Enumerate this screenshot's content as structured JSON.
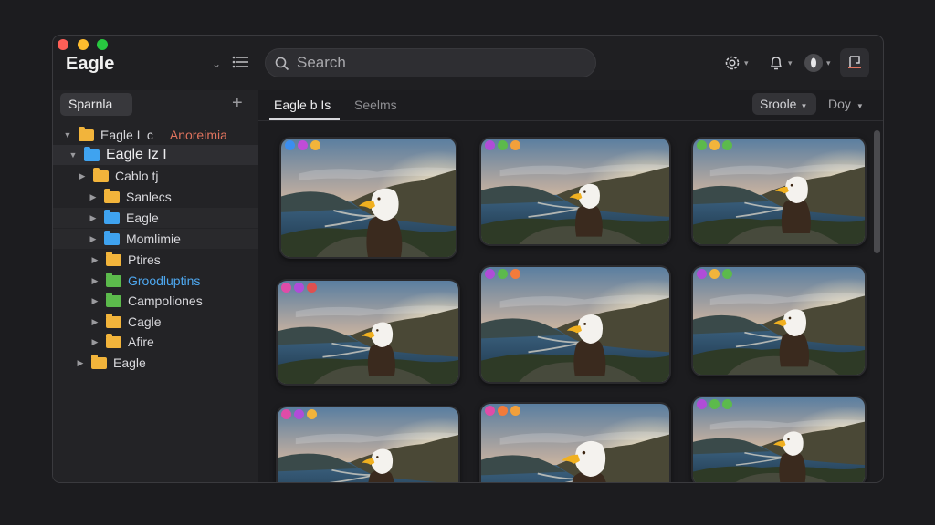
{
  "window": {
    "title": "Eagle"
  },
  "search": {
    "placeholder": "Search"
  },
  "sidebar": {
    "header": "Sparnla",
    "items": [
      {
        "label": "Eagle L c",
        "extra": "Anoreimia",
        "color": "yellow",
        "expanded": true
      },
      {
        "label": "Eagle Iz I",
        "color": "blue",
        "expanded": true
      },
      {
        "label": "Cablo tj",
        "color": "yellow"
      },
      {
        "label": "Sanlecs",
        "color": "yellow"
      },
      {
        "label": "Eagle",
        "color": "blue"
      },
      {
        "label": "Momlimie",
        "color": "blue"
      },
      {
        "label": "Ptires",
        "color": "yellow"
      },
      {
        "label": "Groodluptins",
        "color": "green"
      },
      {
        "label": "Campoliones",
        "color": "green"
      },
      {
        "label": "Cagle",
        "color": "yellow"
      },
      {
        "label": "Afire",
        "color": "yellow"
      },
      {
        "label": "Eagle",
        "color": "yellow"
      }
    ]
  },
  "tabs": [
    {
      "label": "Eagle b Is",
      "active": true
    },
    {
      "label": "Seelms"
    }
  ],
  "toolbar": {
    "sort_label": "Sroole",
    "day_label": "Doy"
  },
  "colors": {
    "folder_yellow": "#f2b43b",
    "folder_blue": "#3fa3f0",
    "folder_green": "#5cba4c",
    "accent_red": "#e0735e"
  },
  "icons": [
    "gear-icon",
    "bell-icon",
    "profile-icon",
    "bookmark-icon",
    "search-icon",
    "list-icon",
    "plus-icon"
  ],
  "images": [
    {
      "tags": [
        "#3b8ef0",
        "#c04cd8",
        "#f2b43b"
      ],
      "subject": "eagle-closeup"
    },
    {
      "tags": [
        "#b04cd8",
        "#5cba4c",
        "#f2a03b"
      ],
      "subject": "eagle-far"
    },
    {
      "tags": [
        "#5cba4c",
        "#f2b43b",
        "#5cba4c"
      ],
      "subject": "eagle-far"
    },
    {
      "tags": [
        "#e04ca8",
        "#b04cd8",
        "#e05050"
      ],
      "subject": "eagle-mid"
    },
    {
      "tags": [
        "#b04cd8",
        "#5cba4c",
        "#f27b3b"
      ],
      "subject": "eagle-mid"
    },
    {
      "tags": [
        "#b04cd8",
        "#f2b43b",
        "#5cba4c"
      ],
      "subject": "eagle-mid"
    },
    {
      "tags": [
        "#e04ca8",
        "#b04cd8",
        "#f2b43b"
      ],
      "subject": "eagle-mid"
    },
    {
      "tags": [
        "#e04ca8",
        "#f27b3b",
        "#f2a03b"
      ],
      "subject": "eagle-closeup"
    },
    {
      "tags": [
        "#b04cd8",
        "#5cba4c",
        "#5cba4c"
      ],
      "subject": "eagle-mid"
    }
  ]
}
